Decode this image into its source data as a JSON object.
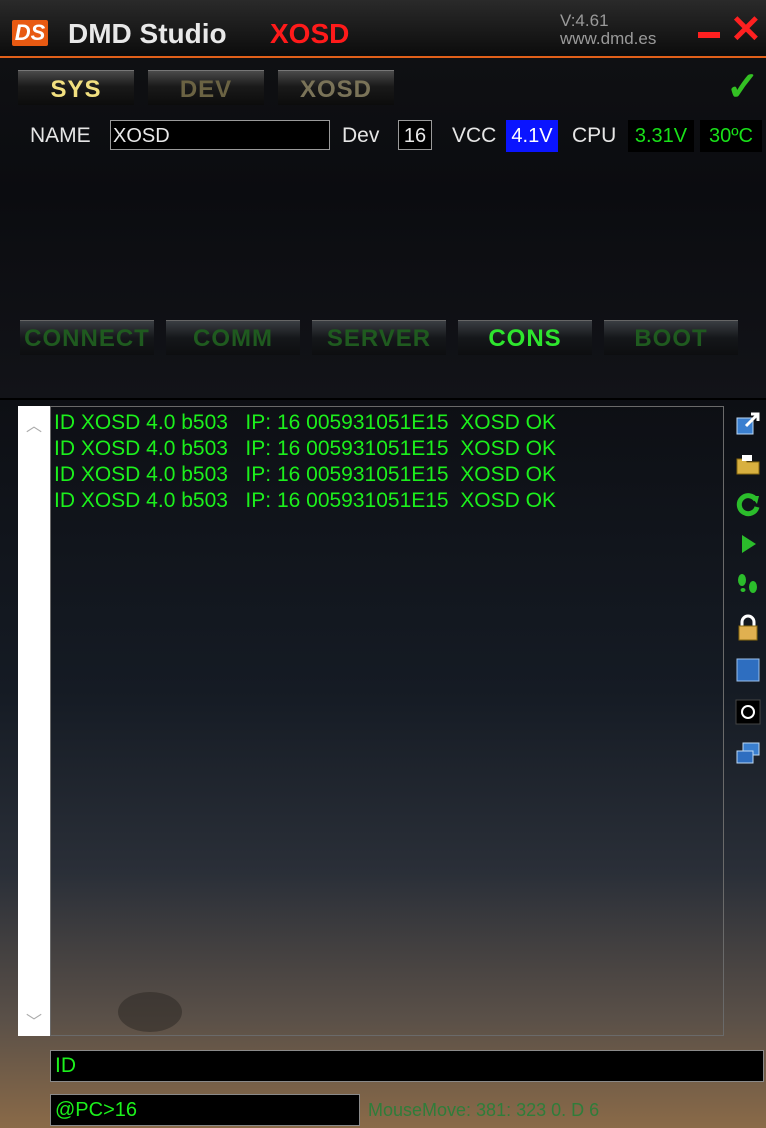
{
  "window": {
    "logo_text": "DS",
    "app_name": "DMD Studio",
    "subtitle": "XOSD",
    "version_line1": "V:4.61",
    "version_line2": "www.dmd.es"
  },
  "tabs": [
    {
      "label": "SYS",
      "active": true
    },
    {
      "label": "DEV",
      "active": false
    },
    {
      "label": "XOSD",
      "active": false
    }
  ],
  "info": {
    "name_label": "NAME",
    "name_value": "XOSD",
    "dev_label": "Dev",
    "dev_value": "16",
    "vcc_label": "VCC",
    "vcc_value": "4.1V",
    "cpu_label": "CPU",
    "cpu_value": "3.31V",
    "temp_value": "30ºC"
  },
  "mode_buttons": [
    {
      "label": "CONNECT",
      "active": false
    },
    {
      "label": "COMM",
      "active": false
    },
    {
      "label": "SERVER",
      "active": false
    },
    {
      "label": "CONS",
      "active": true
    },
    {
      "label": "BOOT",
      "active": false
    }
  ],
  "console": {
    "lines": [
      "ID XOSD 4.0 b503   IP: 16 005931051E15  XOSD OK",
      "ID XOSD 4.0 b503   IP: 16 005931051E15  XOSD OK",
      "ID XOSD 4.0 b503   IP: 16 005931051E15  XOSD OK",
      "ID XOSD 4.0 b503   IP: 16 005931051E15  XOSD OK"
    ],
    "scroll_up": "^",
    "scroll_down": "v",
    "side_icons": [
      "export-icon",
      "folder-open-icon",
      "refresh-icon",
      "play-icon",
      "footsteps-icon",
      "lock-icon",
      "window-icon",
      "record-icon",
      "network-icon"
    ]
  },
  "command_input": "ID",
  "prompt": "@PC>16",
  "status_text": "MouseMove:  381: 323 0. D  6",
  "colors": {
    "accent_green": "#1cf01c",
    "title_red": "#ff1a1a",
    "vcc_blue": "#0a14ff"
  }
}
